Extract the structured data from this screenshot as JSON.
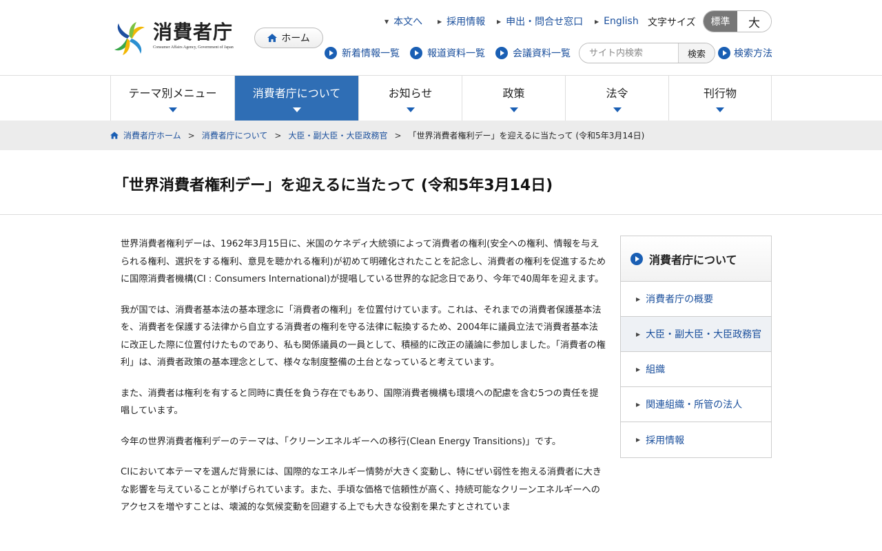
{
  "header": {
    "logo_text": "消費者庁",
    "logo_subtext": "Consumer Affairs Agency, Government of Japan",
    "home_button": "ホーム",
    "util_links": [
      "本文へ",
      "採用情報",
      "申出・問合せ窓口",
      "English"
    ],
    "font_size_label": "文字サイズ",
    "font_size_standard": "標準",
    "font_size_large": "大",
    "sub_links": [
      "新着情報一覧",
      "報道資料一覧",
      "会議資料一覧"
    ],
    "search_placeholder": "サイト内検索",
    "search_button": "検索",
    "search_help": "検索方法"
  },
  "gnav": [
    "テーマ別メニュー",
    "消費者庁について",
    "お知らせ",
    "政策",
    "法令",
    "刊行物"
  ],
  "breadcrumb": {
    "items": [
      "消費者庁ホーム",
      "消費者庁について",
      "大臣・副大臣・大臣政務官"
    ],
    "current": "「世界消費者権利デー」を迎えるに当たって (令和5年3月14日)"
  },
  "page_title": "「世界消費者権利デー」を迎えるに当たって (令和5年3月14日)",
  "body": [
    "世界消費者権利デーは、1962年3月15日に、米国のケネディ大統領によって消費者の権利(安全への権利、情報を与えられる権利、選択をする権利、意見を聴かれる権利)が初めて明確化されたことを記念し、消費者の権利を促進するために国際消費者機構(CI : Consumers International)が提唱している世界的な記念日であり、今年で40周年を迎えます。",
    "我が国では、消費者基本法の基本理念に「消費者の権利」を位置付けています。これは、それまでの消費者保護基本法を、消費者を保護する法律から自立する消費者の権利を守る法律に転換するため、2004年に議員立法で消費者基本法に改正した際に位置付けたものであり、私も関係議員の一員として、積極的に改正の議論に参加しました。「消費者の権利」は、消費者政策の基本理念として、様々な制度整備の土台となっていると考えています。",
    "また、消費者は権利を有すると同時に責任を負う存在でもあり、国際消費者機構も環境への配慮を含む5つの責任を提唱しています。",
    "今年の世界消費者権利デーのテーマは、「クリーンエネルギーへの移行(Clean Energy Transitions)」です。",
    "CIにおいて本テーマを選んだ背景には、国際的なエネルギー情勢が大きく変動し、特にぜい弱性を抱える消費者に大きな影響を与えていることが挙げられています。また、手頃な価格で信頼性が高く、持続可能なクリーンエネルギーへのアクセスを増やすことは、壊滅的な気候変動を回避する上でも大きな役割を果たすとされていま"
  ],
  "side": {
    "title": "消費者庁について",
    "items": [
      "消費者庁の概要",
      "大臣・副大臣・大臣政務官",
      "組織",
      "関連組織・所管の法人",
      "採用情報"
    ]
  },
  "colors": {
    "accent": "#2f6eb5",
    "link": "#1a4f9c"
  }
}
